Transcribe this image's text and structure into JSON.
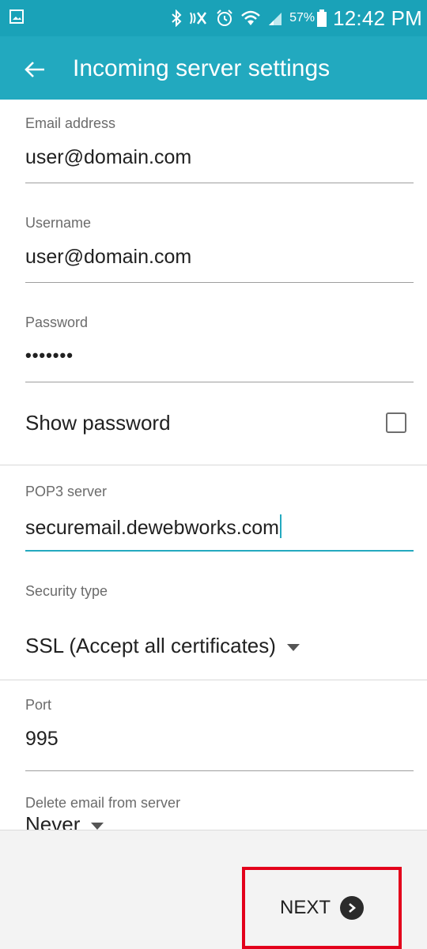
{
  "status_bar": {
    "battery": "57%",
    "time": "12:42 PM",
    "icons": [
      "image-icon",
      "bluetooth-icon",
      "mute-icon",
      "alarm-icon",
      "wifi-icon",
      "signal-icon",
      "battery-icon"
    ]
  },
  "app_bar": {
    "title": "Incoming server settings",
    "back_icon": "arrow-left-icon"
  },
  "form": {
    "email_label": "Email address",
    "email_value": "user@domain.com",
    "username_label": "Username",
    "username_value": "user@domain.com",
    "password_label": "Password",
    "password_value": "•••••••",
    "show_password_label": "Show password",
    "pop3_label": "POP3 server",
    "pop3_value": "securemail.dewebworks.com",
    "security_label": "Security type",
    "security_value": "SSL (Accept all certificates)",
    "port_label": "Port",
    "port_value": "995",
    "delete_label": "Delete email from server",
    "delete_value": "Never"
  },
  "footer": {
    "next_label": "NEXT"
  },
  "colors": {
    "status_bar": "#1aa2b8",
    "app_bar": "#22a9bf",
    "accent": "#24a9bf",
    "highlight_box": "#e3001b"
  }
}
